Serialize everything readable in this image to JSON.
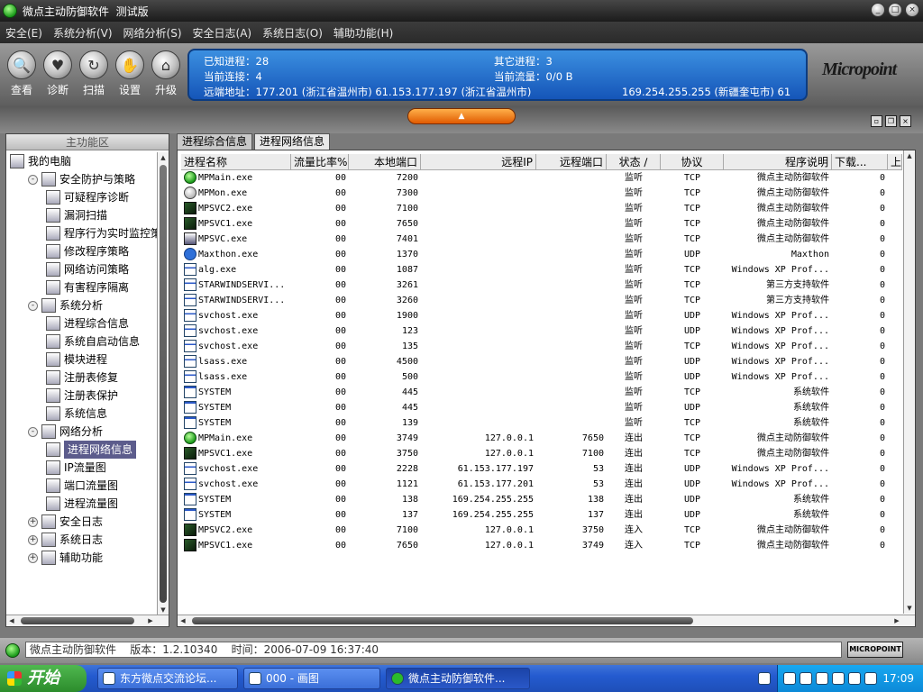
{
  "window": {
    "title": "微点主动防御软件  测试版",
    "buttons": [
      "_",
      "□",
      "×"
    ]
  },
  "menu": [
    "安全(E)",
    "系统分析(V)",
    "网络分析(S)",
    "安全日志(A)",
    "系统日志(O)",
    "辅助功能(H)"
  ],
  "toolbar": [
    {
      "label": "查看",
      "icon": "magnifier-icon"
    },
    {
      "label": "诊断",
      "icon": "heart-icon"
    },
    {
      "label": "扫描",
      "icon": "scan-icon"
    },
    {
      "label": "设置",
      "icon": "hand-icon"
    },
    {
      "label": "升级",
      "icon": "house-icon"
    }
  ],
  "info": {
    "known_processes": "已知进程：28",
    "other_processes": "其它进程：3",
    "current_connections": "当前连接：4",
    "current_traffic": "当前流量：0/0 B",
    "remote": "远端地址：177.201 (浙江省温州市)   61.153.177.197 (浙江省温州市)",
    "remote_2": "169.254.255.255 (新疆奎屯市)   61"
  },
  "logo": {
    "text": "Micropoint"
  },
  "left": {
    "header": "主功能区",
    "tree": [
      {
        "label": "我的电脑",
        "level": 0,
        "expander": ""
      },
      {
        "label": "安全防护与策略",
        "level": 1,
        "expander": "-"
      },
      {
        "label": "可疑程序诊断",
        "level": 2,
        "expander": ""
      },
      {
        "label": "漏洞扫描",
        "level": 2,
        "expander": ""
      },
      {
        "label": "程序行为实时监控策",
        "level": 2,
        "expander": ""
      },
      {
        "label": "修改程序策略",
        "level": 2,
        "expander": ""
      },
      {
        "label": "网络访问策略",
        "level": 2,
        "expander": ""
      },
      {
        "label": "有害程序隔离",
        "level": 2,
        "expander": ""
      },
      {
        "label": "系统分析",
        "level": 1,
        "expander": "-"
      },
      {
        "label": "进程综合信息",
        "level": 2,
        "expander": ""
      },
      {
        "label": "系统自启动信息",
        "level": 2,
        "expander": ""
      },
      {
        "label": "模块进程",
        "level": 2,
        "expander": ""
      },
      {
        "label": "注册表修复",
        "level": 2,
        "expander": ""
      },
      {
        "label": "注册表保护",
        "level": 2,
        "expander": ""
      },
      {
        "label": "系统信息",
        "level": 2,
        "expander": ""
      },
      {
        "label": "网络分析",
        "level": 1,
        "expander": "-"
      },
      {
        "label": "进程网络信息",
        "level": 2,
        "expander": "",
        "selected": true
      },
      {
        "label": "IP流量图",
        "level": 2,
        "expander": ""
      },
      {
        "label": "端口流量图",
        "level": 2,
        "expander": ""
      },
      {
        "label": "进程流量图",
        "level": 2,
        "expander": ""
      },
      {
        "label": "安全日志",
        "level": 1,
        "expander": "+"
      },
      {
        "label": "系统日志",
        "level": 1,
        "expander": "+"
      },
      {
        "label": "辅助功能",
        "level": 1,
        "expander": "+"
      }
    ]
  },
  "tabs": [
    {
      "label": "进程综合信息",
      "active": false
    },
    {
      "label": "进程网络信息",
      "active": true
    }
  ],
  "table": {
    "columns": [
      "进程名称",
      "流量比率%",
      "本地端口",
      "远程IP",
      "远程端口",
      "状态 ∕",
      "协议",
      "程序说明",
      "下载...",
      "上"
    ],
    "rows": [
      [
        "MPMain.exe",
        "00",
        "7200",
        "",
        "",
        "监听",
        "TCP",
        "微点主动防御软件",
        "0",
        "green"
      ],
      [
        "MPMon.exe",
        "00",
        "7300",
        "",
        "",
        "监听",
        "TCP",
        "微点主动防御软件",
        "0",
        "mon"
      ],
      [
        "MPSVC2.exe",
        "00",
        "7100",
        "",
        "",
        "监听",
        "TCP",
        "微点主动防御软件",
        "0",
        "svc"
      ],
      [
        "MPSVC1.exe",
        "00",
        "7650",
        "",
        "",
        "监听",
        "TCP",
        "微点主动防御软件",
        "0",
        "svc"
      ],
      [
        "MPSVC.exe",
        "00",
        "7401",
        "",
        "",
        "监听",
        "TCP",
        "微点主动防御软件",
        "0",
        "svc0"
      ],
      [
        "Maxthon.exe",
        "00",
        "1370",
        "",
        "",
        "监听",
        "UDP",
        "Maxthon",
        "0",
        "maxthon"
      ],
      [
        "alg.exe",
        "00",
        "1087",
        "",
        "",
        "监听",
        "TCP",
        "Windows XP Prof...",
        "0",
        "win"
      ],
      [
        "STARWINDSERVI...",
        "00",
        "3261",
        "",
        "",
        "监听",
        "TCP",
        "第三方支持软件",
        "0",
        "win"
      ],
      [
        "STARWINDSERVI...",
        "00",
        "3260",
        "",
        "",
        "监听",
        "TCP",
        "第三方支持软件",
        "0",
        "win"
      ],
      [
        "svchost.exe",
        "00",
        "1900",
        "",
        "",
        "监听",
        "UDP",
        "Windows XP Prof...",
        "0",
        "win"
      ],
      [
        "svchost.exe",
        "00",
        "123",
        "",
        "",
        "监听",
        "UDP",
        "Windows XP Prof...",
        "0",
        "win"
      ],
      [
        "svchost.exe",
        "00",
        "135",
        "",
        "",
        "监听",
        "TCP",
        "Windows XP Prof...",
        "0",
        "win"
      ],
      [
        "lsass.exe",
        "00",
        "4500",
        "",
        "",
        "监听",
        "UDP",
        "Windows XP Prof...",
        "0",
        "win"
      ],
      [
        "lsass.exe",
        "00",
        "500",
        "",
        "",
        "监听",
        "UDP",
        "Windows XP Prof...",
        "0",
        "win"
      ],
      [
        "SYSTEM",
        "00",
        "445",
        "",
        "",
        "监听",
        "TCP",
        "系统软件",
        "0",
        "sys"
      ],
      [
        "SYSTEM",
        "00",
        "445",
        "",
        "",
        "监听",
        "UDP",
        "系统软件",
        "0",
        "sys"
      ],
      [
        "SYSTEM",
        "00",
        "139",
        "",
        "",
        "监听",
        "TCP",
        "系统软件",
        "0",
        "sys"
      ],
      [
        "MPMain.exe",
        "00",
        "3749",
        "127.0.0.1",
        "7650",
        "连出",
        "TCP",
        "微点主动防御软件",
        "0",
        "green"
      ],
      [
        "MPSVC1.exe",
        "00",
        "3750",
        "127.0.0.1",
        "7100",
        "连出",
        "TCP",
        "微点主动防御软件",
        "0",
        "svc"
      ],
      [
        "svchost.exe",
        "00",
        "2228",
        "61.153.177.197",
        "53",
        "连出",
        "UDP",
        "Windows XP Prof...",
        "0",
        "win"
      ],
      [
        "svchost.exe",
        "00",
        "1121",
        "61.153.177.201",
        "53",
        "连出",
        "UDP",
        "Windows XP Prof...",
        "0",
        "win"
      ],
      [
        "SYSTEM",
        "00",
        "138",
        "169.254.255.255",
        "138",
        "连出",
        "UDP",
        "系统软件",
        "0",
        "sys"
      ],
      [
        "SYSTEM",
        "00",
        "137",
        "169.254.255.255",
        "137",
        "连出",
        "UDP",
        "系统软件",
        "0",
        "sys"
      ],
      [
        "MPSVC2.exe",
        "00",
        "7100",
        "127.0.0.1",
        "3750",
        "连入",
        "TCP",
        "微点主动防御软件",
        "0",
        "svc"
      ],
      [
        "MPSVC1.exe",
        "00",
        "7650",
        "127.0.0.1",
        "3749",
        "连入",
        "TCP",
        "微点主动防御软件",
        "0",
        "svc"
      ]
    ]
  },
  "status": {
    "text": "微点主动防御软件    版本：1.2.10340    时间：2006-07-09 16:37:40",
    "badge": "MICROPOINT"
  },
  "taskbar": {
    "start": "开始",
    "tasks": [
      {
        "label": "东方微点交流论坛...",
        "active": false
      },
      {
        "label": "000 - 画图",
        "active": false
      },
      {
        "label": "微点主动防御软件...",
        "active": true
      }
    ],
    "clock": "17:09"
  }
}
